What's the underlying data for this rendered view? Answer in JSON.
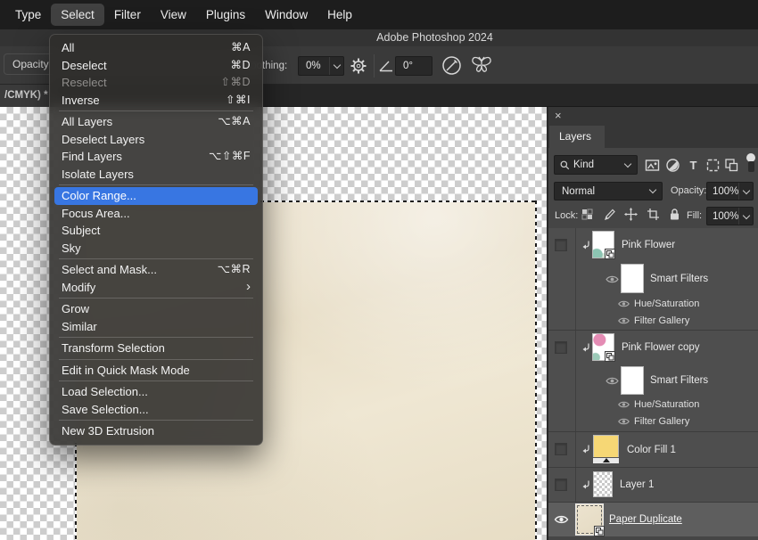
{
  "menu_bar": {
    "items": [
      {
        "label": "Type"
      },
      {
        "label": "Select",
        "active": true
      },
      {
        "label": "Filter"
      },
      {
        "label": "View"
      },
      {
        "label": "Plugins"
      },
      {
        "label": "Window"
      },
      {
        "label": "Help"
      }
    ]
  },
  "title_bar": {
    "title": "Adobe Photoshop 2024"
  },
  "options_bar": {
    "opacity_label": "Opacity",
    "smoothing_label": "Smoothing:",
    "smoothing_value": "0%",
    "angle_value": "0°"
  },
  "document_tab": {
    "label": "/CMYK) *"
  },
  "select_menu": {
    "submenu_arrow": "›",
    "items": [
      {
        "label": "All",
        "shortcut": "⌘A"
      },
      {
        "label": "Deselect",
        "shortcut": "⌘D"
      },
      {
        "label": "Reselect",
        "shortcut": "⇧⌘D",
        "disabled": true
      },
      {
        "label": "Inverse",
        "shortcut": "⇧⌘I"
      },
      {
        "label": "All Layers",
        "shortcut": "⌥⌘A"
      },
      {
        "label": "Deselect Layers",
        "shortcut": ""
      },
      {
        "label": "Find Layers",
        "shortcut": "⌥⇧⌘F"
      },
      {
        "label": "Isolate Layers",
        "shortcut": ""
      },
      {
        "label": "Color Range...",
        "shortcut": "",
        "highlighted": true
      },
      {
        "label": "Focus Area...",
        "shortcut": ""
      },
      {
        "label": "Subject",
        "shortcut": ""
      },
      {
        "label": "Sky",
        "shortcut": ""
      },
      {
        "label": "Select and Mask...",
        "shortcut": "⌥⌘R"
      },
      {
        "label": "Modify",
        "shortcut": "",
        "submenu": true
      },
      {
        "label": "Grow",
        "shortcut": ""
      },
      {
        "label": "Similar",
        "shortcut": ""
      },
      {
        "label": "Transform Selection",
        "shortcut": ""
      },
      {
        "label": "Edit in Quick Mask Mode",
        "shortcut": ""
      },
      {
        "label": "Load Selection...",
        "shortcut": ""
      },
      {
        "label": "Save Selection...",
        "shortcut": ""
      },
      {
        "label": "New 3D Extrusion",
        "shortcut": ""
      }
    ]
  },
  "layers_panel": {
    "close_glyph": "×",
    "tab_label": "Layers",
    "kind_label": "Kind",
    "type_filter_glyph": "T",
    "blend_mode": "Normal",
    "opacity_label": "Opacity:",
    "opacity_value": "100%",
    "lock_label": "Lock:",
    "fill_label": "Fill:",
    "fill_value": "100%",
    "rows": [
      {
        "name": "Pink Flower"
      },
      {
        "name": "Smart Filters"
      },
      {
        "name": "Hue/Saturation"
      },
      {
        "name": "Filter Gallery"
      },
      {
        "name": "Pink Flower copy"
      },
      {
        "name": "Smart Filters"
      },
      {
        "name": "Hue/Saturation"
      },
      {
        "name": "Filter Gallery"
      },
      {
        "name": "Color Fill 1"
      },
      {
        "name": "Layer 1"
      },
      {
        "name": "Paper Duplicate"
      }
    ]
  },
  "colors": {
    "menu_highlight": "#3876e2",
    "selected_row": "#5e5e5e",
    "paper": "#e9dfca",
    "color_fill_swatch": "#f6d775"
  }
}
